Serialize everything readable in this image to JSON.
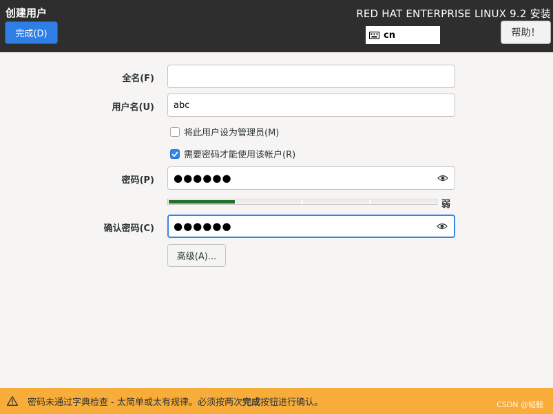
{
  "header": {
    "page_title": "创建用户",
    "done_label": "完成(D)",
    "product_title": "RED HAT ENTERPRISE LINUX 9.2 安装",
    "keyboard_layout": "cn",
    "help_label": "帮助！"
  },
  "form": {
    "fullname_label": "全名(F)",
    "fullname_value": "",
    "username_label": "用户名(U)",
    "username_value": "abc",
    "admin_checkbox_label": "将此用户设为管理员(M)",
    "admin_checked": false,
    "require_password_label": "需要密码才能使用该帐户(R)",
    "require_password_checked": true,
    "password_label": "密码(P)",
    "password_value": "●●●●●●",
    "strength_text": "弱",
    "strength_level": 0.25,
    "confirm_label": "确认密码(C)",
    "confirm_value": "●●●●●●",
    "advanced_label": "高级(A)..."
  },
  "warning": {
    "text_before": "密码未通过字典检查 - 太简单或太有规律。必须按两次",
    "text_bold": "完成",
    "text_after": "按钮进行确认。"
  },
  "watermark": "CSDN @韬毅",
  "colors": {
    "header_bg": "#2e2e2e",
    "accent": "#3584e4",
    "warning_bg": "#f8ac3a",
    "strength_weak": "#26702c"
  }
}
